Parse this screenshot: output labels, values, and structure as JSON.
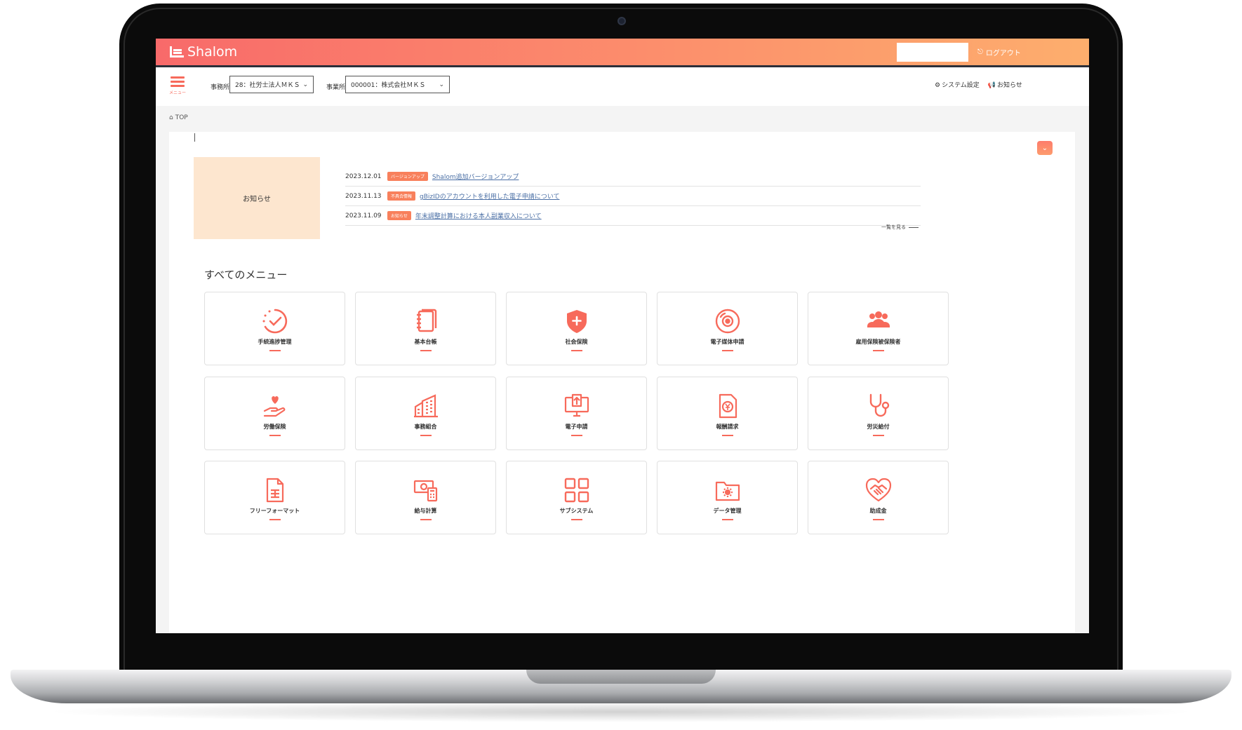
{
  "header": {
    "app_name": "Shalom",
    "logout_label": "ログアウト"
  },
  "subbar": {
    "menu_label": "メニュー",
    "office_label": "事務所",
    "office_value": "28：社労士法人ＭＫＳ",
    "business_label": "事業所",
    "business_value": "000001：株式会社ＭＫＳ",
    "system_settings": "システム設定",
    "notice": "お知らせ"
  },
  "breadcrumb": {
    "home": "TOP"
  },
  "news": {
    "heading": "お知らせ",
    "items": [
      {
        "date": "2023.12.01",
        "badge": "バージョンアップ",
        "title": "Shalom追加バージョンアップ"
      },
      {
        "date": "2023.11.13",
        "badge": "不具合情報",
        "title": "gBizIDのアカウントを利用した電子申請について"
      },
      {
        "date": "2023.11.09",
        "badge": "お知らせ",
        "title": "年末調整計算における本人副業収入について"
      }
    ],
    "more_label": "一覧を見る"
  },
  "menu": {
    "title": "すべてのメニュー",
    "items": [
      {
        "label": "手続進捗管理",
        "icon": "progress-check-icon"
      },
      {
        "label": "基本台帳",
        "icon": "ledger-icon"
      },
      {
        "label": "社会保険",
        "icon": "shield-plus-icon"
      },
      {
        "label": "電子媒体申請",
        "icon": "disc-icon"
      },
      {
        "label": "雇用保険被保険者",
        "icon": "people-group-icon"
      },
      {
        "label": "労働保険",
        "icon": "hand-heart-icon"
      },
      {
        "label": "事務組合",
        "icon": "building-icon"
      },
      {
        "label": "電子申請",
        "icon": "monitor-upload-icon"
      },
      {
        "label": "報酬請求",
        "icon": "yen-document-icon"
      },
      {
        "label": "労災給付",
        "icon": "stethoscope-icon"
      },
      {
        "label": "フリーフォーマット",
        "icon": "spreadsheet-icon"
      },
      {
        "label": "給与計算",
        "icon": "money-calculator-icon"
      },
      {
        "label": "サブシステム",
        "icon": "grid-squares-icon"
      },
      {
        "label": "データ管理",
        "icon": "folder-gear-icon"
      },
      {
        "label": "助成金",
        "icon": "handshake-heart-icon"
      }
    ]
  },
  "colors": {
    "accent": "#f76a5b",
    "header_start": "#f86a6a",
    "header_end": "#fdae6d",
    "news_box": "#fde6cf"
  }
}
